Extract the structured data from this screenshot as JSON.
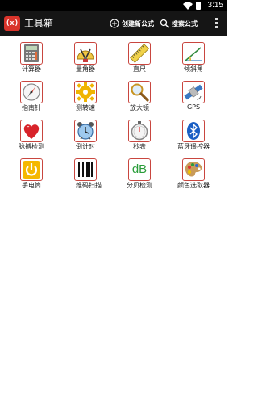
{
  "status_bar": {
    "time": "3:15"
  },
  "action_bar": {
    "logo_text": "(x)",
    "title": "工具箱",
    "create_label": "创建新公式",
    "search_label": "搜索公式"
  },
  "tools": [
    {
      "label": "计算器",
      "icon": "calculator-icon"
    },
    {
      "label": "量角器",
      "icon": "protractor-icon"
    },
    {
      "label": "直尺",
      "icon": "ruler-icon"
    },
    {
      "label": "倾斜角",
      "icon": "inclinometer-icon"
    },
    {
      "label": "指南针",
      "icon": "compass-icon"
    },
    {
      "label": "测转速",
      "icon": "gear-icon"
    },
    {
      "label": "放大镜",
      "icon": "magnifier-icon"
    },
    {
      "label": "GPS",
      "icon": "satellite-icon"
    },
    {
      "label": "脉搏检测",
      "icon": "heart-icon"
    },
    {
      "label": "倒计时",
      "icon": "alarm-clock-icon"
    },
    {
      "label": "秒表",
      "icon": "stopwatch-icon"
    },
    {
      "label": "蓝牙遥控器",
      "icon": "bluetooth-icon"
    },
    {
      "label": "手电筒",
      "icon": "power-icon"
    },
    {
      "label": "二维码扫描",
      "icon": "barcode-icon"
    },
    {
      "label": "分贝检测",
      "icon": "decibel-icon"
    },
    {
      "label": "颜色选取器",
      "icon": "palette-icon"
    }
  ],
  "decibel_text": "dB"
}
